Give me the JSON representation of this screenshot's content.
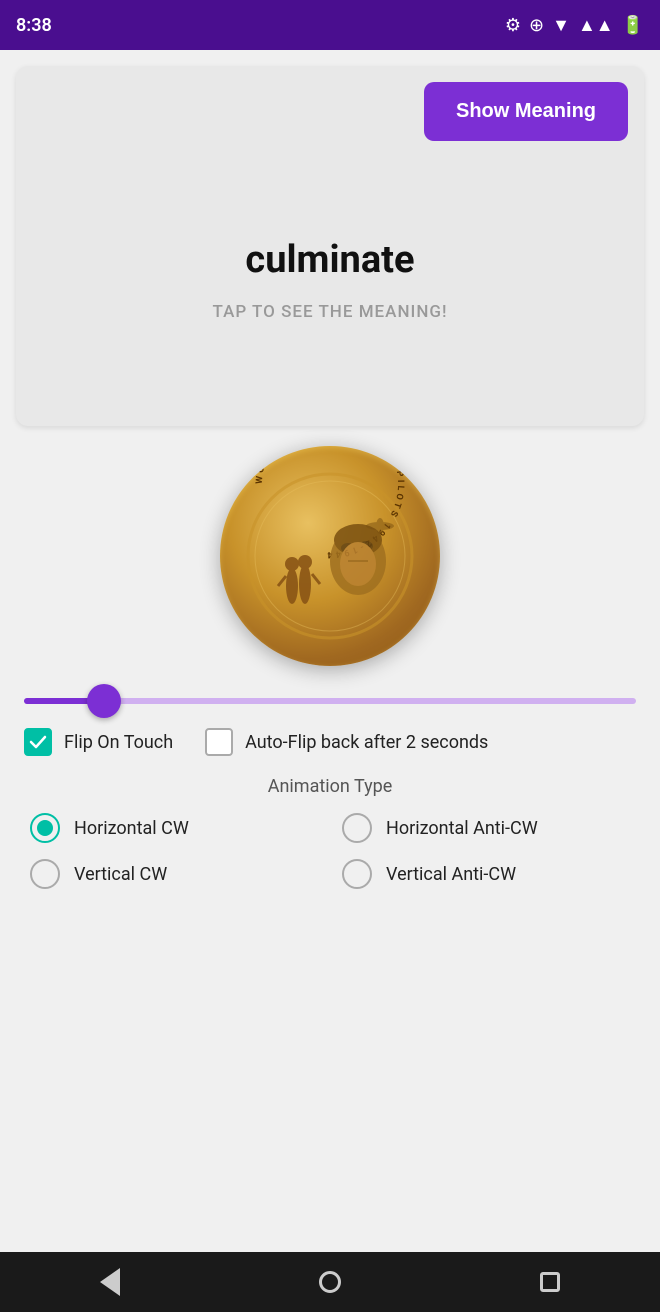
{
  "statusBar": {
    "time": "8:38",
    "icons": [
      "settings",
      "signal",
      "wifi",
      "battery"
    ]
  },
  "card": {
    "showMeaningLabel": "Show Meaning",
    "word": "culminate",
    "tapHint": "TAP TO SEE THE MEANING!"
  },
  "slider": {
    "value": 13,
    "min": 0,
    "max": 100
  },
  "options": {
    "flipOnTouch": {
      "label": "Flip On Touch",
      "checked": true
    },
    "autoFlip": {
      "label": "Auto-Flip back after 2 seconds",
      "checked": false
    }
  },
  "animationType": {
    "title": "Animation Type",
    "options": [
      {
        "id": "hcw",
        "label": "Horizontal CW",
        "selected": true
      },
      {
        "id": "hacw",
        "label": "Horizontal Anti-CW",
        "selected": false
      },
      {
        "id": "vcw",
        "label": "Vertical CW",
        "selected": false
      },
      {
        "id": "vacw",
        "label": "Vertical Anti-CW",
        "selected": false
      }
    ]
  },
  "navBar": {
    "back": "back",
    "home": "home",
    "recents": "recents"
  }
}
